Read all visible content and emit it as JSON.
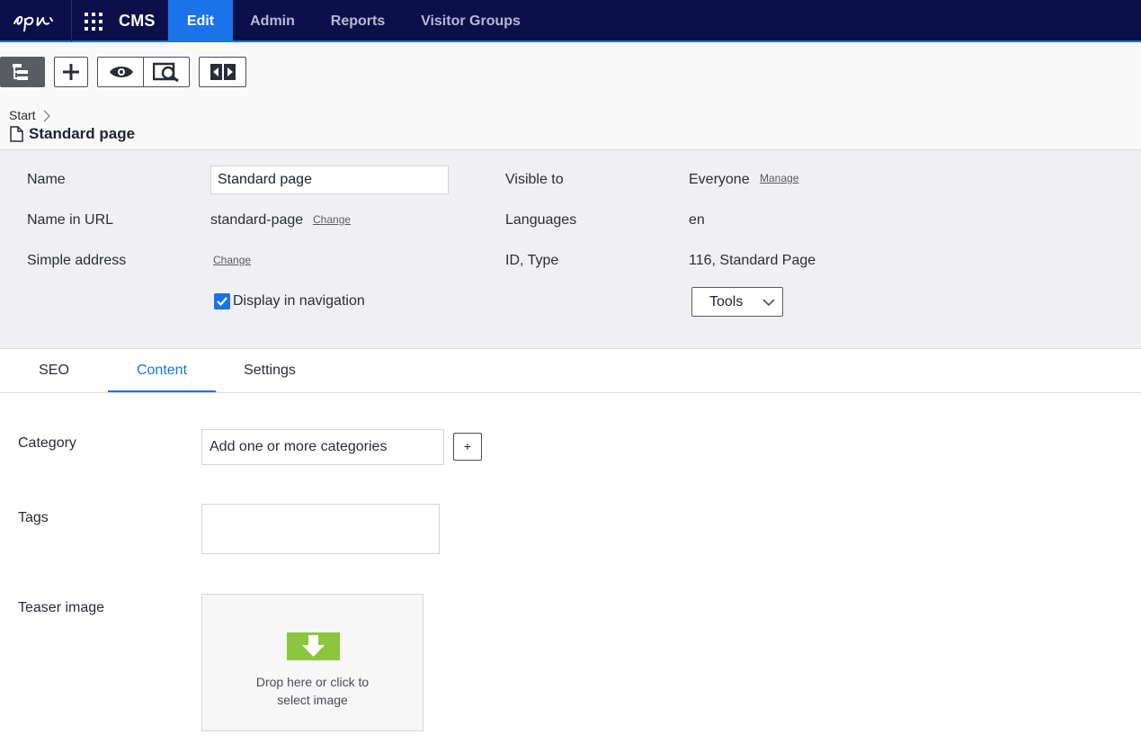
{
  "nav": {
    "brand": "CMS",
    "tabs": [
      {
        "label": "Edit",
        "active": true
      },
      {
        "label": "Admin",
        "active": false
      },
      {
        "label": "Reports",
        "active": false
      },
      {
        "label": "Visitor Groups",
        "active": false
      }
    ],
    "accent_color": "#1a73e8",
    "bar_color": "#0b0f4a"
  },
  "toolbar": {
    "buttons": [
      "page-tree-icon",
      "plus-icon",
      "eye-icon",
      "preview-search-icon",
      "compare-icon"
    ]
  },
  "breadcrumb": {
    "root": "Start",
    "current": "Standard page"
  },
  "properties": {
    "name_label": "Name",
    "name_value": "Standard page",
    "url_label": "Name in URL",
    "url_value": "standard-page",
    "url_change": "Change",
    "simple_label": "Simple address",
    "simple_change": "Change",
    "nav_checkbox_label": "Display in navigation",
    "nav_checkbox_checked": true,
    "visible_label": "Visible to",
    "visible_value": "Everyone",
    "visible_manage": "Manage",
    "languages_label": "Languages",
    "languages_value": "en",
    "id_label": "ID, Type",
    "id_value": "116, Standard Page",
    "tools_label": "Tools"
  },
  "tabs": [
    {
      "label": "SEO",
      "active": false
    },
    {
      "label": "Content",
      "active": true
    },
    {
      "label": "Settings",
      "active": false
    }
  ],
  "content": {
    "category_label": "Category",
    "category_placeholder": "Add one or more categories",
    "category_add": "+",
    "tags_label": "Tags",
    "tags_value": "",
    "teaser_label": "Teaser image",
    "teaser_drop_line1": "Drop here or click to",
    "teaser_drop_line2": "select image",
    "drop_icon_color": "#8cc63f"
  }
}
